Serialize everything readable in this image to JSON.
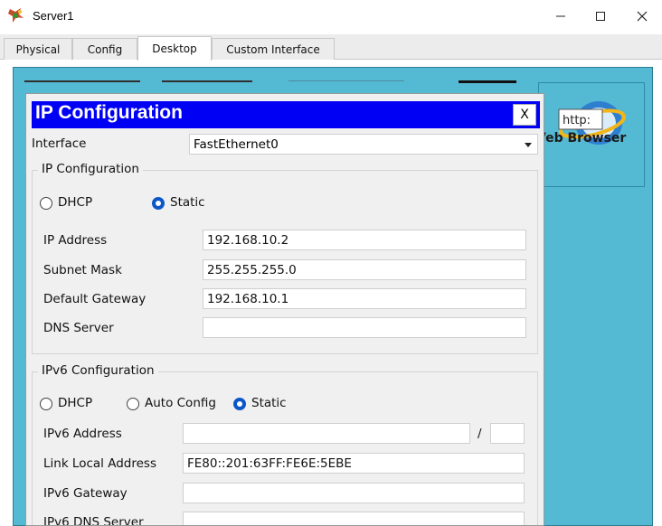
{
  "window": {
    "title": "Server1",
    "app_icon": "packet-tracer-server-icon",
    "minimize_icon": "minimize-icon",
    "maximize_icon": "maximize-icon",
    "close_icon": "close-icon"
  },
  "tabs": [
    {
      "label": "Physical"
    },
    {
      "label": "Config"
    },
    {
      "label": "Desktop",
      "selected": true
    },
    {
      "label": "Custom Interface"
    }
  ],
  "desktop": {
    "background_color": "#54b9d3",
    "web_browser": {
      "label": "Veb Browser",
      "icon_text": "http:",
      "icon": "web-browser-globe-icon"
    }
  },
  "ip_config": {
    "title": "IP Configuration",
    "close_label": "X",
    "header_color": "#0000f4",
    "interface_label": "Interface",
    "interface_value": "FastEthernet0",
    "ipv4": {
      "legend": "IP Configuration",
      "dhcp_label": "DHCP",
      "static_label": "Static",
      "mode": "static",
      "ip_address_label": "IP Address",
      "ip_address": "192.168.10.2",
      "subnet_mask_label": "Subnet Mask",
      "subnet_mask": "255.255.255.0",
      "gateway_label": "Default Gateway",
      "gateway": "192.168.10.1",
      "dns_label": "DNS Server",
      "dns": ""
    },
    "ipv6": {
      "legend": "IPv6 Configuration",
      "dhcp_label": "DHCP",
      "auto_label": "Auto Config",
      "static_label": "Static",
      "mode": "static",
      "address_label": "IPv6 Address",
      "address": "",
      "prefix_sep": "/",
      "prefix": "",
      "link_local_label": "Link Local Address",
      "link_local": "FE80::201:63FF:FE6E:5EBE",
      "gateway_label": "IPv6 Gateway",
      "gateway": "",
      "dns_label": "IPv6 DNS Server",
      "dns": ""
    }
  }
}
